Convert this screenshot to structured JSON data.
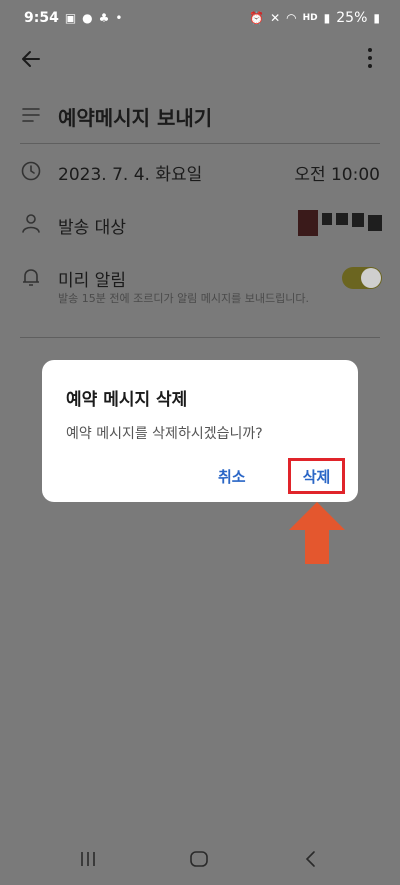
{
  "status_bar": {
    "time": "9:54",
    "battery": "25%",
    "network": "HD"
  },
  "screen": {
    "title": "예약메시지 보내기",
    "date": "2023. 7. 4. 화요일",
    "time": "오전 10:00",
    "recipient_label": "발송 대상",
    "reminder_label": "미리 알림",
    "reminder_desc": "발송 15분 전에 조르디가 알림 메시지를 보내드립니다.",
    "reminder_on": true
  },
  "dialog": {
    "title": "예약 메시지 삭제",
    "message": "예약 메시지를 삭제하시겠습니까?",
    "cancel_label": "취소",
    "delete_label": "삭제"
  },
  "colors": {
    "highlight_box": "#e0242a",
    "arrow": "#e4572e",
    "dialog_button": "#2a66c6"
  },
  "icons": {
    "back": "arrow-left-icon",
    "more": "more-vertical-icon",
    "title": "lines-icon",
    "date": "clock-icon",
    "recipient": "person-icon",
    "reminder": "bell-icon"
  }
}
